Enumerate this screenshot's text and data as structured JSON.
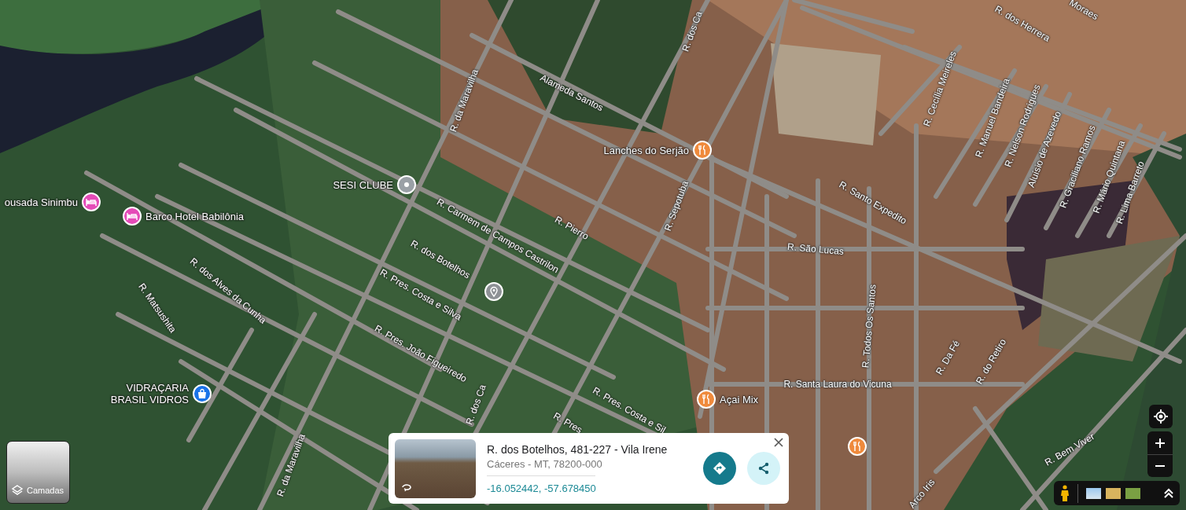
{
  "map": {
    "streets": [
      {
        "name": "R. dos Ca"
      },
      {
        "name": "R. dos Herrera"
      },
      {
        "name": "Moraes"
      },
      {
        "name": "Alameda Santos"
      },
      {
        "name": "R. da Maravilha"
      },
      {
        "name": "R. Cecília Meireles"
      },
      {
        "name": "R. Manuel Bandeira"
      },
      {
        "name": "R. Nelson Rodrigues"
      },
      {
        "name": "Aluísio de Azevedo"
      },
      {
        "name": "R. Graciliano Ramos"
      },
      {
        "name": "R. Mário Quintana"
      },
      {
        "name": "R. Lima Barreto"
      },
      {
        "name": "R. Sepotuba"
      },
      {
        "name": "R. Santo Expedito"
      },
      {
        "name": "R. Pierro"
      },
      {
        "name": "R. Carmem de Campos Castrilon"
      },
      {
        "name": "R. São Lucas"
      },
      {
        "name": "R. dos Botelhos"
      },
      {
        "name": "R. Pres. Costa e Silva"
      },
      {
        "name": "R. Pres. João Figueiredo"
      },
      {
        "name": "R. dos Alves da Cunha"
      },
      {
        "name": "R. Matsushita"
      },
      {
        "name": "R. Todos Os Santos"
      },
      {
        "name": "R. Da Fé"
      },
      {
        "name": "R. do Retiro"
      },
      {
        "name": "R. Santa Laura do Vicuna"
      },
      {
        "name": "R. Pres. Costa e Sil"
      },
      {
        "name": "R. Bem Viver"
      },
      {
        "name": "R. dos Ca"
      },
      {
        "name": "R. Pres"
      },
      {
        "name": "Arco Iris"
      },
      {
        "name": "R. da Maravilha"
      }
    ],
    "places": [
      {
        "name": "ousada Sinimbu",
        "kind": "lodging",
        "color": "#e54bb8"
      },
      {
        "name": "Barco Hotel Babilônia",
        "kind": "lodging",
        "color": "#e54bb8"
      },
      {
        "name": "SESI CLUBE",
        "kind": "place",
        "color": "#9aa0a6"
      },
      {
        "name": "Lanches do Serjão",
        "kind": "restaurant",
        "color": "#ef8a3c"
      },
      {
        "name": "VIDRAÇARIA\nBRASIL VIDROS",
        "kind": "shop",
        "color": "#1a73e8"
      },
      {
        "name": "Açai Mix",
        "kind": "restaurant",
        "color": "#ef8a3c"
      },
      {
        "kind": "restaurant",
        "color": "#ef8a3c"
      },
      {
        "kind": "pin",
        "color": "#8e9196"
      }
    ]
  },
  "layers_button": {
    "label": "Camadas"
  },
  "place_card": {
    "title": "R. dos Botelhos, 481-227 - Vila Irene",
    "subtitle": "Cáceres - MT, 78200-000",
    "coordinates": "-16.052442, -57.678450"
  }
}
